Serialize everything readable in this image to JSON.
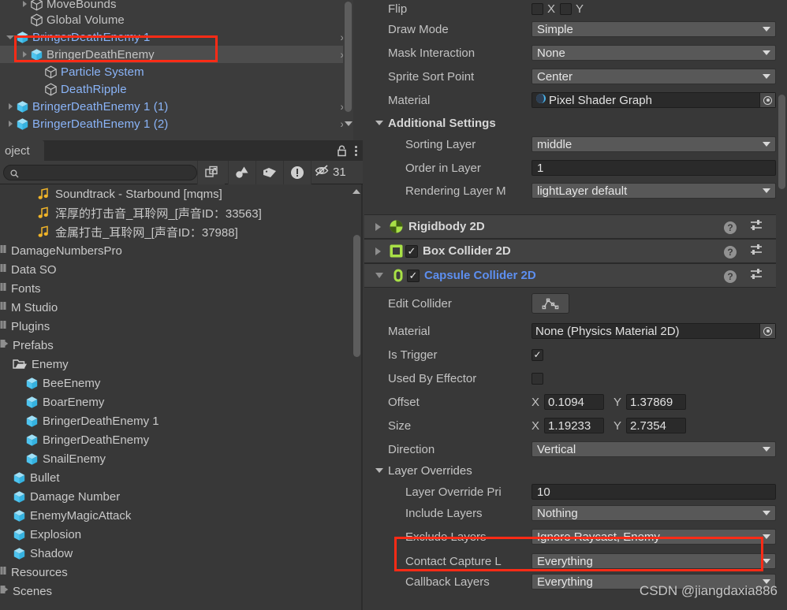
{
  "hierarchy": {
    "rows": [
      {
        "label": "MoveBounds",
        "indent": 1,
        "icon": "cube-outline-icon",
        "twisty": "closed",
        "color": "normal",
        "chevron": false,
        "selected": false,
        "clipped": true
      },
      {
        "label": "Global Volume",
        "indent": 1,
        "icon": "cube-outline-icon",
        "twisty": "none",
        "color": "normal",
        "chevron": false,
        "selected": false
      },
      {
        "label": "BringerDeathEnemy 1",
        "indent": 0,
        "icon": "prefab-cube-icon",
        "twisty": "open",
        "color": "prefab",
        "chevron": true,
        "selected": false
      },
      {
        "label": "BringerDeathEnemy",
        "indent": 1,
        "icon": "prefab-cube-icon",
        "twisty": "closed",
        "color": "normal",
        "chevron": true,
        "selected": true
      },
      {
        "label": "Particle System",
        "indent": 2,
        "icon": "cube-outline-icon",
        "twisty": "none",
        "color": "prefab",
        "chevron": false,
        "selected": false
      },
      {
        "label": "DeathRipple",
        "indent": 2,
        "icon": "cube-outline-icon",
        "twisty": "none",
        "color": "prefab",
        "chevron": false,
        "selected": false
      },
      {
        "label": "BringerDeathEnemy 1 (1)",
        "indent": 0,
        "icon": "prefab-cube-icon",
        "twisty": "closed",
        "color": "prefab",
        "chevron": true,
        "selected": false
      },
      {
        "label": "BringerDeathEnemy 1 (2)",
        "indent": 0,
        "icon": "prefab-cube-icon",
        "twisty": "closed",
        "color": "prefab",
        "chevron": true,
        "selected": false
      }
    ]
  },
  "project": {
    "tab_label": "oject",
    "search": {
      "value": "",
      "placeholder": ""
    },
    "hidden_count": "31",
    "rows": [
      {
        "label": "Soundtrack - Starbound [mqms]",
        "indent": 3,
        "icon": "audio-icon"
      },
      {
        "label": "浑厚的打击音_耳聆网_[声音ID：33563]",
        "indent": 3,
        "icon": "audio-icon"
      },
      {
        "label": "金属打击_耳聆网_[声音ID：37988]",
        "indent": 3,
        "icon": "audio-icon"
      },
      {
        "label": "DamageNumbersPro",
        "indent": 0,
        "icon": "folder-collapsed-icon"
      },
      {
        "label": "Data SO",
        "indent": 0,
        "icon": "folder-collapsed-icon"
      },
      {
        "label": "Fonts",
        "indent": 0,
        "icon": "folder-collapsed-icon"
      },
      {
        "label": "M Studio",
        "indent": 0,
        "icon": "folder-collapsed-icon"
      },
      {
        "label": "Plugins",
        "indent": 0,
        "icon": "folder-collapsed-icon"
      },
      {
        "label": "Prefabs",
        "indent": 0,
        "icon": "folder-open-small-icon"
      },
      {
        "label": "Enemy",
        "indent": 1,
        "icon": "folder-open-icon"
      },
      {
        "label": "BeeEnemy",
        "indent": 2,
        "icon": "prefab-cube-icon"
      },
      {
        "label": "BoarEnemy",
        "indent": 2,
        "icon": "prefab-cube-icon"
      },
      {
        "label": "BringerDeathEnemy 1",
        "indent": 2,
        "icon": "prefab-cube-icon"
      },
      {
        "label": "BringerDeathEnemy",
        "indent": 2,
        "icon": "prefab-cube-icon"
      },
      {
        "label": "SnailEnemy",
        "indent": 2,
        "icon": "prefab-cube-icon"
      },
      {
        "label": "Bullet",
        "indent": 1,
        "icon": "prefab-cube-icon"
      },
      {
        "label": "Damage Number",
        "indent": 1,
        "icon": "prefab-cube-icon"
      },
      {
        "label": "EnemyMagicAttack",
        "indent": 1,
        "icon": "prefab-cube-icon"
      },
      {
        "label": "Explosion",
        "indent": 1,
        "icon": "prefab-cube-icon"
      },
      {
        "label": "Shadow",
        "indent": 1,
        "icon": "prefab-cube-icon"
      },
      {
        "label": "Resources",
        "indent": 0,
        "icon": "folder-collapsed-icon"
      },
      {
        "label": "Scenes",
        "indent": 0,
        "icon": "folder-open-small-icon"
      }
    ]
  },
  "inspector": {
    "sprite_renderer": {
      "flip_label": "Flip",
      "flip_x_label": "X",
      "flip_y_label": "Y",
      "draw_mode_label": "Draw Mode",
      "draw_mode_value": "Simple",
      "mask_interaction_label": "Mask Interaction",
      "mask_interaction_value": "None",
      "sprite_sort_point_label": "Sprite Sort Point",
      "sprite_sort_point_value": "Center",
      "material_label": "Material",
      "material_value": "Pixel Shader Graph"
    },
    "additional_settings": {
      "title": "Additional Settings",
      "sorting_layer_label": "Sorting Layer",
      "sorting_layer_value": "middle",
      "order_in_layer_label": "Order in Layer",
      "order_in_layer_value": "1",
      "rendering_layer_label": "Rendering Layer M",
      "rendering_layer_value": "lightLayer default"
    },
    "components": [
      {
        "name": "Rigidbody 2D",
        "expanded": false,
        "has_checkbox": false,
        "checked": false,
        "icon": "rigidbody2d-icon",
        "link": false
      },
      {
        "name": "Box Collider 2D",
        "expanded": false,
        "has_checkbox": true,
        "checked": true,
        "icon": "boxcollider2d-icon",
        "link": false
      },
      {
        "name": "Capsule Collider 2D",
        "expanded": true,
        "has_checkbox": true,
        "checked": true,
        "icon": "capsulecollider2d-icon",
        "link": true
      }
    ],
    "capsule_collider": {
      "edit_collider_label": "Edit Collider",
      "material_label": "Material",
      "material_value": "None (Physics Material 2D)",
      "is_trigger_label": "Is Trigger",
      "is_trigger_checked": true,
      "used_by_effector_label": "Used By Effector",
      "used_by_effector_checked": false,
      "offset_label": "Offset",
      "offset_x_axis": "X",
      "offset_x": "0.1094 ",
      "offset_y_axis": "Y",
      "offset_y": "1.37869",
      "size_label": "Size",
      "size_x_axis": "X",
      "size_x": "1.19233",
      "size_y_axis": "Y",
      "size_y": "2.7354",
      "direction_label": "Direction",
      "direction_value": "Vertical"
    },
    "layer_overrides": {
      "title": "Layer Overrides",
      "priority_label": "Layer Override Pri",
      "priority_value": "10",
      "include_label": "Include Layers",
      "include_value": "Nothing",
      "exclude_label": "Exclude Layers",
      "exclude_value": "Ignore Raycast, Enemy",
      "contact_capture_label": "Contact Capture L",
      "contact_capture_value": "Everything",
      "callback_label": "Callback Layers",
      "callback_value": "Everything"
    }
  },
  "watermark": "CSDN @jiangdaxia886",
  "colors": {
    "panel_bg": "#383838",
    "hierarchy_bg": "#3c3c3c",
    "selection": "#4d4d4d",
    "prefab_blue": "#8ab4f8",
    "link_blue": "#5d8ff0",
    "highlight_red": "#fc2b16",
    "component_green": "#a8e046"
  }
}
